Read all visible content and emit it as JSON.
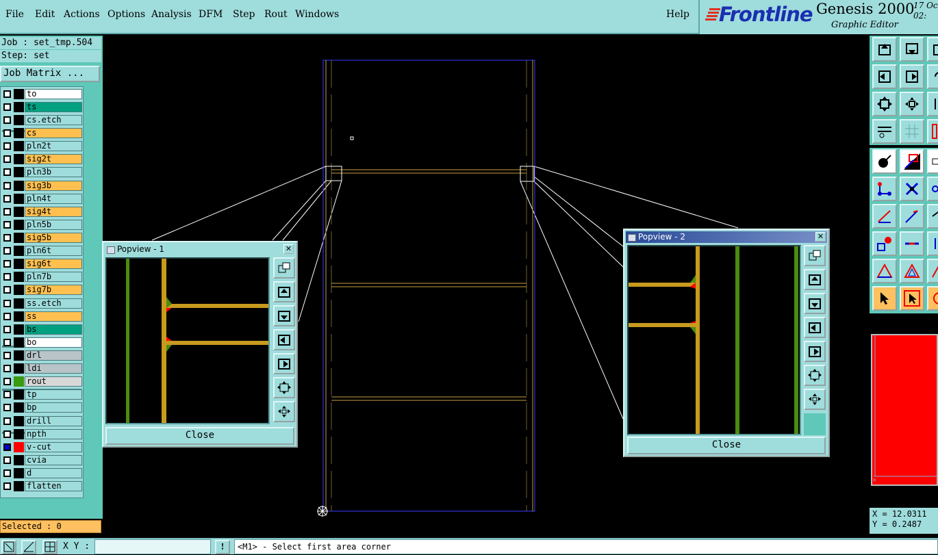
{
  "menu": [
    "File",
    "Edit",
    "Actions",
    "Options",
    "Analysis",
    "DFM",
    "Step",
    "Rout",
    "Windows"
  ],
  "help": "Help",
  "brand": {
    "logo": "Frontline",
    "title": "Genesis 2000",
    "subtitle": "Graphic Editor",
    "date_line1": "17 Oc",
    "date_line2": "02:"
  },
  "job": "Job : set_tmp.504",
  "step": "Step: set",
  "job_matrix_label": "Job Matrix ...",
  "layers": [
    {
      "name": "to",
      "color": "#ffffff"
    },
    {
      "name": "ts",
      "color": "#00a080"
    },
    {
      "name": "cs.etch",
      "color": "#9fdcdc"
    },
    {
      "name": "cs",
      "color": "#ffc050"
    },
    {
      "name": "pln2t",
      "color": "#9fdcdc"
    },
    {
      "name": "sig2t",
      "color": "#ffc050"
    },
    {
      "name": "pln3b",
      "color": "#9fdcdc"
    },
    {
      "name": "sig3b",
      "color": "#ffc050"
    },
    {
      "name": "pln4t",
      "color": "#9fdcdc"
    },
    {
      "name": "sig4t",
      "color": "#ffc050"
    },
    {
      "name": "pln5b",
      "color": "#9fdcdc"
    },
    {
      "name": "sig5b",
      "color": "#ffc050"
    },
    {
      "name": "pln6t",
      "color": "#9fdcdc"
    },
    {
      "name": "sig6t",
      "color": "#ffc050"
    },
    {
      "name": "pln7b",
      "color": "#9fdcdc"
    },
    {
      "name": "sig7b",
      "color": "#ffc050"
    },
    {
      "name": "ss.etch",
      "color": "#9fdcdc"
    },
    {
      "name": "ss",
      "color": "#ffc050"
    },
    {
      "name": "bs",
      "color": "#00a080"
    },
    {
      "name": "bo",
      "color": "#ffffff"
    },
    {
      "name": "drl",
      "color": "#b8c4c8"
    },
    {
      "name": "ldi",
      "color": "#b8c4c8"
    },
    {
      "name": "rout",
      "color": "#d8d8d8"
    },
    {
      "name": "tp",
      "color": "#9fdcdc"
    },
    {
      "name": "bp",
      "color": "#9fdcdc"
    },
    {
      "name": "drill",
      "color": "#9fdcdc"
    },
    {
      "name": "npth",
      "color": "#9fdcdc"
    },
    {
      "name": "v-cut",
      "color": "#9fdcdc"
    },
    {
      "name": "cvia",
      "color": "#9fdcdc"
    },
    {
      "name": "d",
      "color": "#9fdcdc"
    },
    {
      "name": "flatten",
      "color": "#9fdcdc"
    }
  ],
  "selected": "Selected : 0",
  "xy_label": "X Y :",
  "xy_value": "",
  "status": "<M1> - Select first area corner",
  "coords": {
    "x": "X = 12.0311",
    "y": "Y = 0.2487"
  },
  "popview1": {
    "title": "Popview - 1",
    "close": "Close"
  },
  "popview2": {
    "title": "Popview - 2",
    "close": "Close"
  },
  "colors": {
    "panel": "#9fdcdc",
    "trace": "#c89a1e",
    "green": "#4a8c10",
    "red": "#ff0000",
    "title_bar": "#3c5ca8"
  }
}
